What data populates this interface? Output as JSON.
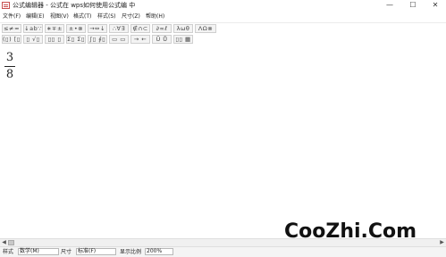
{
  "window": {
    "title": "公式编辑器 - 公式在 wps如何使用公式编 中",
    "minimize": "—",
    "maximize": "☐",
    "close": "✕"
  },
  "menu": [
    "文件(F)",
    "编辑(E)",
    "视图(V)",
    "格式(T)",
    "样式(S)",
    "尺寸(Z)",
    "帮助(H)"
  ],
  "toolbar_row1": [
    "≤≠≈",
    "↓ab∵",
    "∗∓±",
    "±•⊗",
    "→⇔↓",
    "∴∀∃",
    "∉∩⊂",
    "∂∞ℓ",
    "λωθ",
    "ΛΩ⊗"
  ],
  "toolbar_row2": [
    "(▯) [▯]",
    "▯ √▯",
    "▯▯ ▯",
    "Σ▯ Σ▯",
    "∫▯ ∮▯",
    "▭ ▭",
    "→ ←",
    "Ũ Ů",
    "▯▯ ▦"
  ],
  "equation": {
    "numerator": "3",
    "denominator": "8"
  },
  "watermark": "CooZhi.Com",
  "status": {
    "style_label": "样式",
    "style_value": "数学(M)",
    "size_label": "尺寸",
    "size_value": "标准(F)",
    "zoom_label": "显示比例",
    "zoom_value": "200%"
  },
  "colors": {
    "icon_accent": "#c85050",
    "toolbar_bg": "#f3f3f3",
    "status_bg": "#f4f4f4"
  }
}
